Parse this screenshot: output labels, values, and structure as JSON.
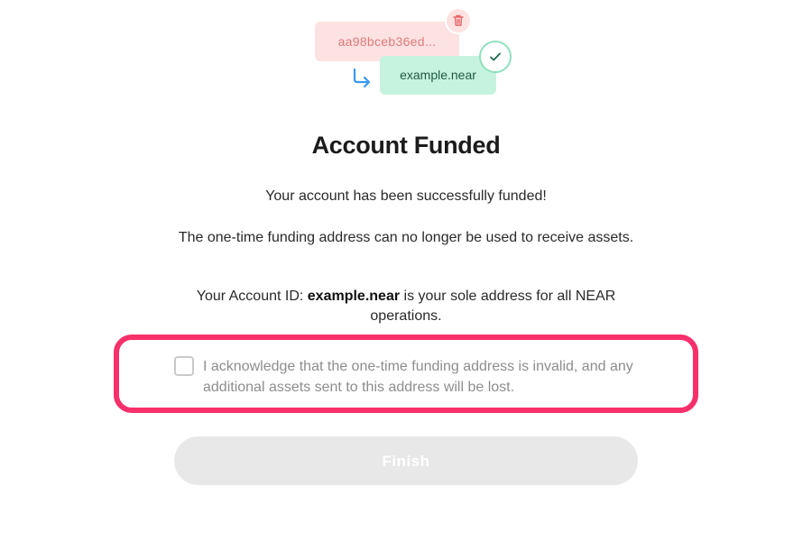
{
  "illustration": {
    "old_address": "aa98bceb36ed...",
    "new_address": "example.near",
    "icons": {
      "trash": "trash-icon",
      "arrow": "arrow-down-right-icon",
      "check": "check-icon"
    }
  },
  "title": "Account Funded",
  "messages": {
    "funded": "Your account has been successfully funded!",
    "no_longer_used": "The one-time funding address can no longer be used to receive assets.",
    "account_id_prefix": "Your Account ID: ",
    "account_id": "example.near",
    "account_id_suffix": " is your sole address for all NEAR operations."
  },
  "acknowledgement": {
    "checked": false,
    "label": "I acknowledge that the one-time funding address is invalid, and any additional assets sent to this address will be lost."
  },
  "finish_button": {
    "label": "Finish",
    "disabled": true
  },
  "colors": {
    "highlight": "#f7306b",
    "old_address_bg": "#fde2e2",
    "new_address_bg": "#c6f3df",
    "arrow": "#3a9af0"
  }
}
